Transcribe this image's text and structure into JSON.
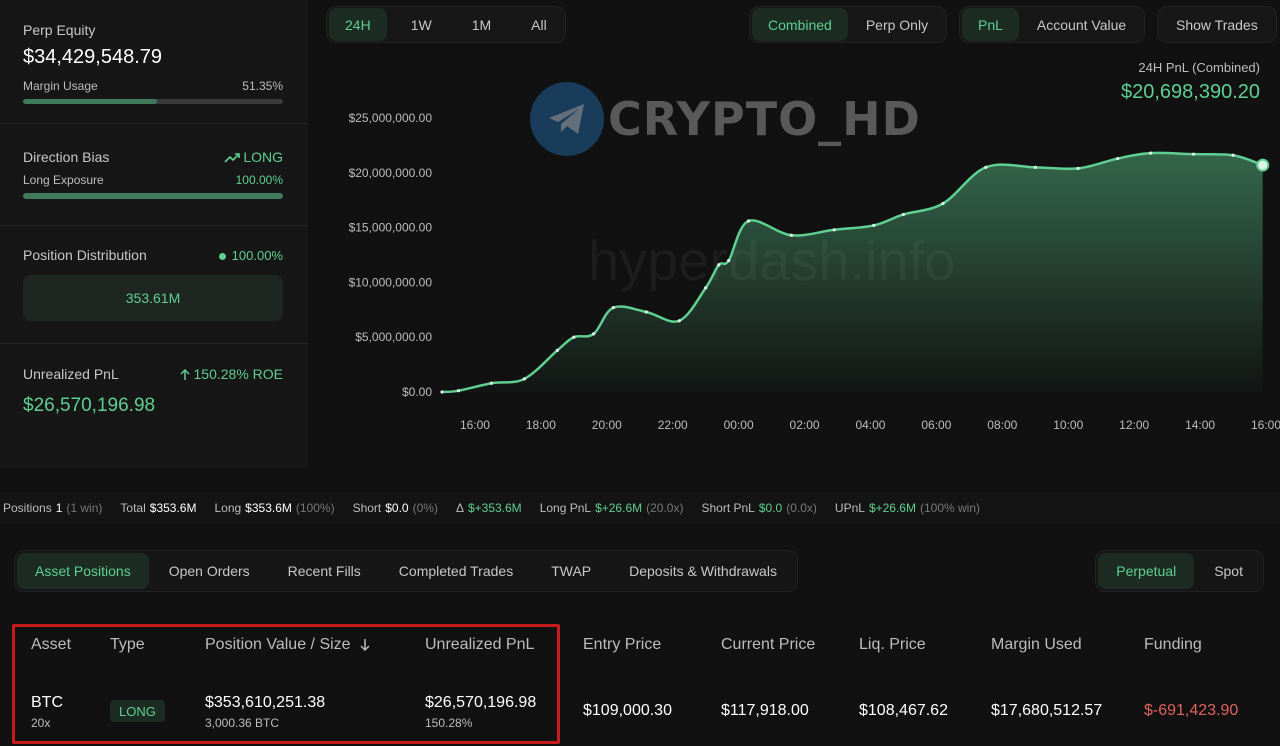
{
  "left": {
    "equity_label": "Perp Equity",
    "equity_value": "$34,429,548.79",
    "margin_label": "Margin Usage",
    "margin_pct": "51.35%",
    "margin_fraction": 0.5135,
    "bias_label": "Direction Bias",
    "bias_value": "LONG",
    "long_exposure_label": "Long Exposure",
    "long_exposure_pct": "100.00%",
    "long_exposure_fraction": 1.0,
    "dist_label": "Position Distribution",
    "dist_pct": "100.00%",
    "dist_value": "353.61M",
    "upnl_label": "Unrealized PnL",
    "upnl_roe": "150.28% ROE",
    "upnl_value": "$26,570,196.98"
  },
  "timeframes": [
    "24H",
    "1W",
    "1M",
    "All"
  ],
  "modes": [
    "Combined",
    "Perp Only"
  ],
  "metrics": [
    "PnL",
    "Account Value"
  ],
  "show_trades": "Show Trades",
  "chart_header": {
    "label": "24H PnL (Combined)",
    "value": "$20,698,390.20"
  },
  "watermark": {
    "brand": "CRYPTO_HD",
    "site": "hyperdash.info"
  },
  "chart_data": {
    "type": "area",
    "title": "",
    "xlabel": "",
    "ylabel": "",
    "x_ticks": [
      "16:00",
      "18:00",
      "20:00",
      "22:00",
      "00:00",
      "02:00",
      "04:00",
      "06:00",
      "08:00",
      "10:00",
      "12:00",
      "14:00",
      "16:00"
    ],
    "y_ticks": [
      "$0.00",
      "$5,000,000.00",
      "$10,000,000.00",
      "$15,000,000.00",
      "$20,000,000.00",
      "$25,000,000.00"
    ],
    "ylim": [
      0,
      25000000
    ],
    "xlim_hours": [
      0,
      25
    ],
    "color": "#5fcf92",
    "grid": false,
    "series": [
      {
        "x": [
          0,
          0.5,
          1.5,
          2.5,
          3.5,
          4.0,
          4.6,
          5.2,
          6.2,
          7.2,
          8.0,
          8.4,
          8.7,
          9.3,
          10.6,
          11.9,
          13.1,
          14.0,
          15.2,
          16.5,
          18.0,
          19.3,
          20.5,
          21.5,
          22.8,
          24.0,
          24.9
        ],
        "y": [
          0,
          120000,
          800000,
          1200000,
          3800000,
          5000000,
          5300000,
          7700000,
          7300000,
          6500000,
          9500000,
          11600000,
          12000000,
          15600000,
          14300000,
          14800000,
          15200000,
          16200000,
          17200000,
          20500000,
          20500000,
          20400000,
          21300000,
          21800000,
          21700000,
          21600000,
          20698390
        ]
      }
    ]
  },
  "summary": {
    "positions_label": "Positions",
    "positions_value": "1",
    "positions_meta": "(1 win)",
    "total_label": "Total",
    "total_value": "$353.6M",
    "long_label": "Long",
    "long_value": "$353.6M",
    "long_meta": "(100%)",
    "short_label": "Short",
    "short_value": "$0.0",
    "short_meta": "(0%)",
    "delta_label": "Δ",
    "delta_value": "$+353.6M",
    "longpnl_label": "Long PnL",
    "longpnl_value": "$+26.6M",
    "longpnl_meta": "(20.0x)",
    "shortpnl_label": "Short PnL",
    "shortpnl_value": "$0.0",
    "shortpnl_meta": "(0.0x)",
    "upnl_label": "UPnL",
    "upnl_value": "$+26.6M",
    "upnl_meta": "(100% win)"
  },
  "bottom_tabs": [
    "Asset Positions",
    "Open Orders",
    "Recent Fills",
    "Completed Trades",
    "TWAP",
    "Deposits & Withdrawals"
  ],
  "market_tabs": [
    "Perpetual",
    "Spot"
  ],
  "table": {
    "headers": [
      "Asset",
      "Type",
      "Position Value / Size",
      "Unrealized PnL",
      "Entry Price",
      "Current Price",
      "Liq. Price",
      "Margin Used",
      "Funding"
    ],
    "row": {
      "asset": "BTC",
      "leverage": "20x",
      "type": "LONG",
      "value": "$353,610,251.38",
      "size": "3,000.36 BTC",
      "upnl": "$26,570,196.98",
      "upnl_pct": "150.28%",
      "entry": "$109,000.30",
      "current": "$117,918.00",
      "liq": "$108,467.62",
      "margin": "$17,680,512.57",
      "funding": "$-691,423.90"
    }
  },
  "colors": {
    "accent": "#5fcf92",
    "negative": "#e0625c",
    "highlight": "#c8191d"
  }
}
